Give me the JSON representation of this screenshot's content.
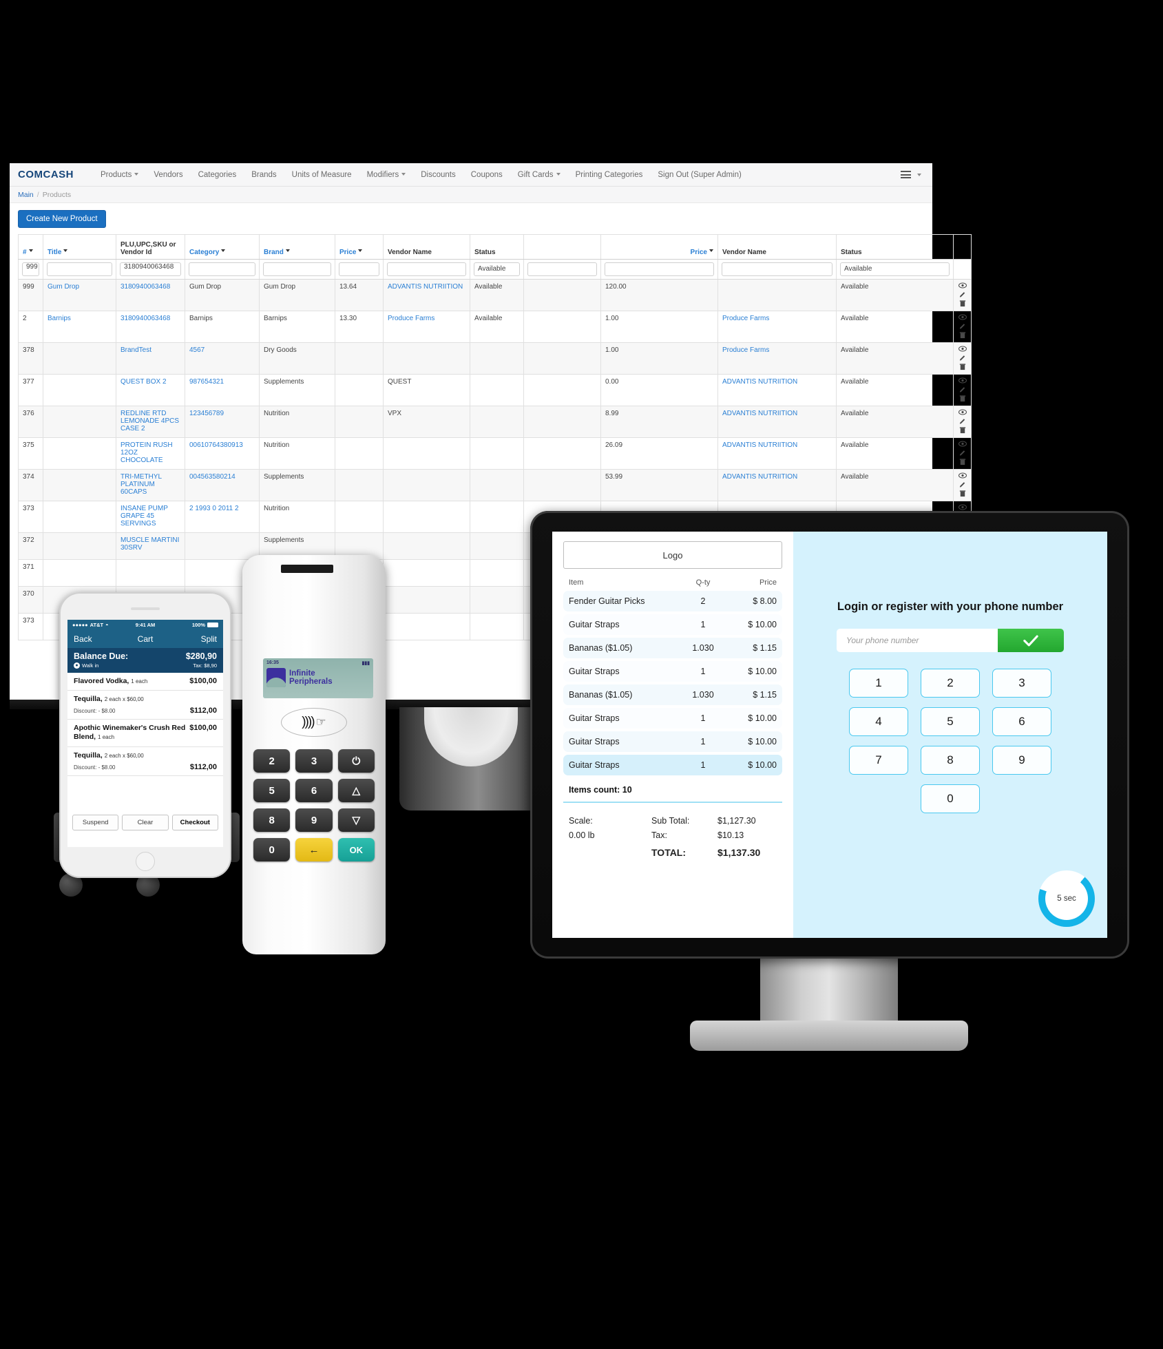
{
  "admin": {
    "brand": "COMCASH",
    "nav": [
      {
        "label": "Products",
        "dropdown": true
      },
      {
        "label": "Vendors",
        "dropdown": false
      },
      {
        "label": "Categories",
        "dropdown": false
      },
      {
        "label": "Brands",
        "dropdown": false
      },
      {
        "label": "Units of Measure",
        "dropdown": false
      },
      {
        "label": "Modifiers",
        "dropdown": true
      },
      {
        "label": "Discounts",
        "dropdown": false
      },
      {
        "label": "Coupons",
        "dropdown": false
      },
      {
        "label": "Gift Cards",
        "dropdown": true
      },
      {
        "label": "Printing Categories",
        "dropdown": false
      },
      {
        "label": "Sign Out (Super Admin)",
        "dropdown": false
      }
    ],
    "breadcrumb": {
      "root": "Main",
      "sep": "/",
      "current": "Products"
    },
    "create_button": "Create New Product",
    "columns": [
      {
        "label": "#",
        "sortable": true
      },
      {
        "label": "Title",
        "sortable": true
      },
      {
        "label": "PLU,UPC,SKU or Vendor Id",
        "sortable": false
      },
      {
        "label": "Category",
        "sortable": true
      },
      {
        "label": "Brand",
        "sortable": true
      },
      {
        "label": "Price",
        "sortable": true
      },
      {
        "label": "Vendor Name",
        "sortable": false
      },
      {
        "label": "Status",
        "sortable": false
      },
      {
        "label": "",
        "sortable": false
      },
      {
        "label": "Price",
        "sortable": true
      },
      {
        "label": "Vendor Name",
        "sortable": false
      },
      {
        "label": "Status",
        "sortable": false
      }
    ],
    "filters": {
      "num": "999",
      "title": "",
      "plu": "3180940063468",
      "category": "",
      "brand": "",
      "price": "",
      "vendor": "",
      "status": "Available",
      "extra": "",
      "price2": "",
      "vendor2": "",
      "status2": "Available"
    },
    "rows": [
      {
        "num": "999",
        "title": "Gum Drop",
        "plu": "3180940063468",
        "category": "Gum Drop",
        "brand": "Gum Drop",
        "price": "13.64",
        "vendor": "ADVANTIS NUTRIITION",
        "status": "Available",
        "extra": "",
        "price2": "120.00",
        "vendor2": "",
        "status2": "Available"
      },
      {
        "num": "2",
        "title": "Barnips",
        "plu": "3180940063468",
        "category": "Barnips",
        "brand": "Barnips",
        "price": "13.30",
        "vendor": "Produce Farms",
        "status": "Available",
        "extra": "",
        "price2": "1.00",
        "vendor2": "Produce Farms",
        "status2": "Available"
      },
      {
        "num": "378",
        "title": "",
        "plu": "BrandTest",
        "category": "4567",
        "brand": "Dry Goods",
        "price": "",
        "vendor": "",
        "status": "",
        "extra": "",
        "price2": "1.00",
        "vendor2": "Produce Farms",
        "status2": "Available"
      },
      {
        "num": "377",
        "title": "",
        "plu": "QUEST BOX 2",
        "category": "987654321",
        "brand": "Supplements",
        "price": "",
        "vendor": "QUEST",
        "status": "",
        "extra": "",
        "price2": "0.00",
        "vendor2": "ADVANTIS NUTRIITION",
        "status2": "Available"
      },
      {
        "num": "376",
        "title": "",
        "plu": "REDLINE RTD LEMONADE 4PCS CASE 2",
        "category": "123456789",
        "brand": "Nutrition",
        "price": "",
        "vendor": "VPX",
        "status": "",
        "extra": "",
        "price2": "8.99",
        "vendor2": "ADVANTIS NUTRIITION",
        "status2": "Available"
      },
      {
        "num": "375",
        "title": "",
        "plu": "PROTEIN RUSH 12OZ CHOCOLATE",
        "category": "00610764380913",
        "brand": "Nutrition",
        "price": "",
        "vendor": "",
        "status": "",
        "extra": "",
        "price2": "26.09",
        "vendor2": "ADVANTIS NUTRIITION",
        "status2": "Available"
      },
      {
        "num": "374",
        "title": "",
        "plu": "TRI-METHYL PLATINUM 60CAPS",
        "category": "004563580214",
        "brand": "Supplements",
        "price": "",
        "vendor": "",
        "status": "",
        "extra": "",
        "price2": "53.99",
        "vendor2": "ADVANTIS NUTRIITION",
        "status2": "Available"
      },
      {
        "num": "373",
        "title": "",
        "plu": "INSANE PUMP GRAPE 45 SERVINGS",
        "category": "2 1993 0 2011 2",
        "brand": "Nutrition",
        "price": "",
        "vendor": "",
        "status": "",
        "extra": "",
        "price2": "",
        "vendor2": "",
        "status2": ""
      },
      {
        "num": "372",
        "title": "",
        "plu": "MUSCLE MARTINI 30SRV",
        "category": "",
        "brand": "Supplements",
        "price": "",
        "vendor": "",
        "status": "",
        "extra": "",
        "price2": "",
        "vendor2": "",
        "status2": ""
      },
      {
        "num": "371",
        "title": "",
        "plu": "",
        "category": "",
        "brand": "",
        "price": "",
        "vendor": "",
        "status": "",
        "extra": "",
        "price2": "",
        "vendor2": "",
        "status2": ""
      },
      {
        "num": "370",
        "title": "",
        "plu": "",
        "category": "",
        "brand": "",
        "price": "",
        "vendor": "",
        "status": "",
        "extra": "",
        "price2": "",
        "vendor2": "",
        "status2": ""
      },
      {
        "num": "373",
        "title": "",
        "plu": "",
        "category": "",
        "brand": "",
        "price": "",
        "vendor": "",
        "status": "",
        "extra": "",
        "price2": "",
        "vendor2": "",
        "status2": ""
      }
    ],
    "row_actions": [
      "view-icon",
      "edit-icon",
      "delete-icon"
    ]
  },
  "pos": {
    "logo_label": "Logo",
    "receipt_headers": {
      "item": "Item",
      "qty": "Q-ty",
      "price": "Price"
    },
    "receipt_items": [
      {
        "item": "Fender Guitar Picks",
        "qty": "2",
        "price": "$ 8.00"
      },
      {
        "item": "Guitar Straps",
        "qty": "1",
        "price": "$ 10.00"
      },
      {
        "item": "Bananas ($1.05)",
        "qty": "1.030",
        "price": "$ 1.15"
      },
      {
        "item": "Guitar Straps",
        "qty": "1",
        "price": "$ 10.00"
      },
      {
        "item": "Bananas ($1.05)",
        "qty": "1.030",
        "price": "$ 1.15"
      },
      {
        "item": "Guitar Straps",
        "qty": "1",
        "price": "$ 10.00"
      },
      {
        "item": "Guitar Straps",
        "qty": "1",
        "price": "$ 10.00"
      },
      {
        "item": "Guitar Straps",
        "qty": "1",
        "price": "$ 10.00"
      }
    ],
    "items_count": "Items count: 10",
    "scale_label": "Scale:",
    "scale_value": "0.00 lb",
    "subtotal_label": "Sub Total:",
    "subtotal_value": "$1,127.30",
    "tax_label": "Tax:",
    "tax_value": "$10.13",
    "total_label": "TOTAL:",
    "total_value": "$1,137.30",
    "login_title": "Login or register with your phone number",
    "phone_placeholder": "Your phone number",
    "submit_icon": "check-icon",
    "keypad": [
      "1",
      "2",
      "3",
      "4",
      "5",
      "6",
      "7",
      "8",
      "9",
      "0"
    ],
    "timer_label": "5 sec",
    "accent_color": "#14b4e8",
    "panel_bg": "#d5f2fd",
    "submit_color": "#2fb93a"
  },
  "phone": {
    "carrier": "AT&T",
    "time": "9:41 AM",
    "battery": "100%",
    "nav_back": "Back",
    "nav_title": "Cart",
    "nav_split": "Split",
    "balance_label": "Balance Due:",
    "balance_value": "$280,90",
    "customer": "Walk in",
    "tax_line": "Tax: $8,90",
    "items": [
      {
        "name": "Flavored Vodka,",
        "qty": "1 each",
        "amount": "$100,00",
        "discount": ""
      },
      {
        "name": "Tequilla,",
        "qty": "2 each x $60,00",
        "amount": "$112,00",
        "discount": "Discount: - $8.00"
      },
      {
        "name": "Apothic Winemaker's Crush Red Blend,",
        "qty": "1 each",
        "amount": "$100,00",
        "discount": ""
      },
      {
        "name": "Tequilla,",
        "qty": "2 each x $60,00",
        "amount": "$112,00",
        "discount": "Discount: - $8.00"
      }
    ],
    "buttons": {
      "suspend": "Suspend",
      "clear": "Clear",
      "checkout": "Checkout"
    }
  },
  "terminal": {
    "lcd_time": "16:35",
    "lcd_battery": "batt-icon",
    "brand_line1": "Infinite",
    "brand_line2": "Peripherals",
    "nfc_icon": "contactless-tap-icon",
    "keys": [
      "2",
      "3",
      "power",
      "5",
      "6",
      "up",
      "8",
      "9",
      "down",
      "0",
      "back",
      "OK"
    ]
  }
}
